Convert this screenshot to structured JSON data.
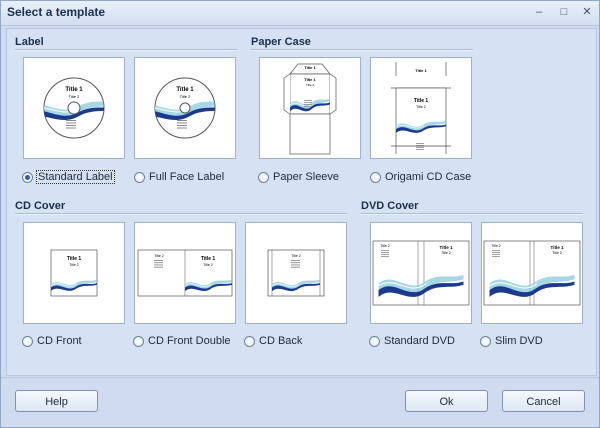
{
  "window": {
    "title": "Select a template"
  },
  "sections": {
    "label": "Label",
    "paper_case": "Paper Case",
    "cd_cover": "CD Cover",
    "dvd_cover": "DVD Cover"
  },
  "thumb_text": {
    "title1": "Title 1",
    "title2": "Title 2"
  },
  "options": {
    "standard_label": {
      "label": "Standard Label",
      "selected": true
    },
    "full_face_label": {
      "label": "Full Face Label",
      "selected": false
    },
    "paper_sleeve": {
      "label": "Paper Sleeve",
      "selected": false
    },
    "origami_cd_case": {
      "label": "Origami CD Case",
      "selected": false
    },
    "cd_front": {
      "label": "CD Front",
      "selected": false
    },
    "cd_front_double": {
      "label": "CD Front Double",
      "selected": false
    },
    "cd_back": {
      "label": "CD Back",
      "selected": false
    },
    "standard_dvd": {
      "label": "Standard DVD",
      "selected": false
    },
    "slim_dvd": {
      "label": "Slim DVD",
      "selected": false
    }
  },
  "buttons": {
    "help": "Help",
    "ok": "Ok",
    "cancel": "Cancel"
  },
  "icons": {
    "minimize": "minimize-icon",
    "maximize": "maximize-icon",
    "close": "close-icon"
  },
  "colors": {
    "accent": "#2e5da8",
    "wave_dark": "#1c3a8c",
    "wave_light": "#7fc7d9"
  }
}
